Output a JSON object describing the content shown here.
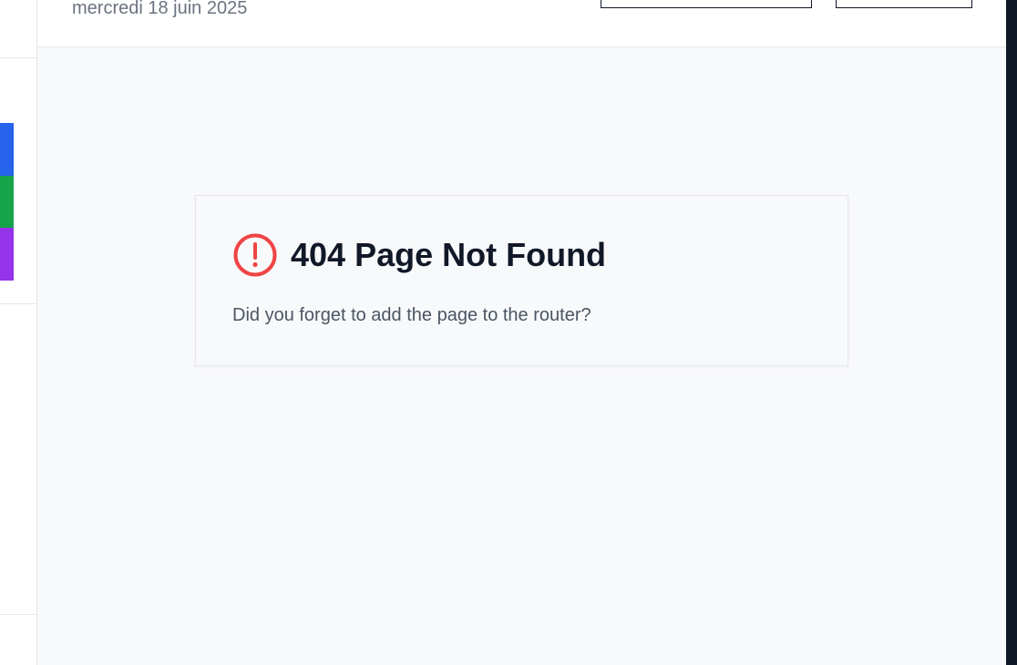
{
  "header": {
    "date": "mercredi 18 juin 2025"
  },
  "sidebar": {
    "tab_colors": [
      "#2563eb",
      "#16a34a",
      "#9333ea"
    ]
  },
  "error": {
    "title": "404 Page Not Found",
    "message": "Did you forget to add the page to the router?",
    "icon": "alert-circle-icon",
    "icon_color": "#ef4444"
  }
}
